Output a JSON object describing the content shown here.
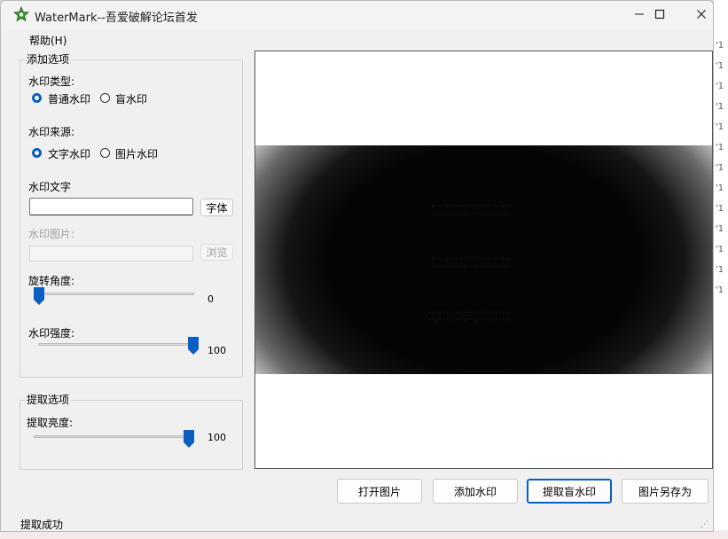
{
  "window": {
    "title": "WaterMark--吾爱破解论坛首发"
  },
  "menu": {
    "help": "帮助(H)"
  },
  "add_options": {
    "group_title": "添加选项",
    "type_label": "水印类型:",
    "type_options": [
      "普通水印",
      "盲水印"
    ],
    "type_selected": "普通水印",
    "source_label": "水印来源:",
    "source_options": [
      "文字水印",
      "图片水印"
    ],
    "source_selected": "文字水印",
    "text_label": "水印文字",
    "text_value": "",
    "font_button": "字体",
    "image_label": "水印图片:",
    "image_value": "",
    "browse_button": "浏览",
    "rotation_label": "旋转角度:",
    "rotation_value": "0",
    "strength_label": "水印强度:",
    "strength_value": "100"
  },
  "extract_options": {
    "group_title": "提取选项",
    "brightness_label": "提取亮度:",
    "brightness_value": "100"
  },
  "buttons": {
    "open": "打开图片",
    "add": "添加水印",
    "extract": "提取盲水印",
    "save_as": "图片另存为"
  },
  "status": {
    "text": "提取成功"
  },
  "icons": {
    "app": "star-logo-icon",
    "minimize": "minimize-icon",
    "maximize": "maximize-icon",
    "close": "close-icon",
    "grip": "resize-grip-icon"
  },
  "colors": {
    "accent": "#0a5fc2",
    "window_bg": "#f0f0f0"
  }
}
